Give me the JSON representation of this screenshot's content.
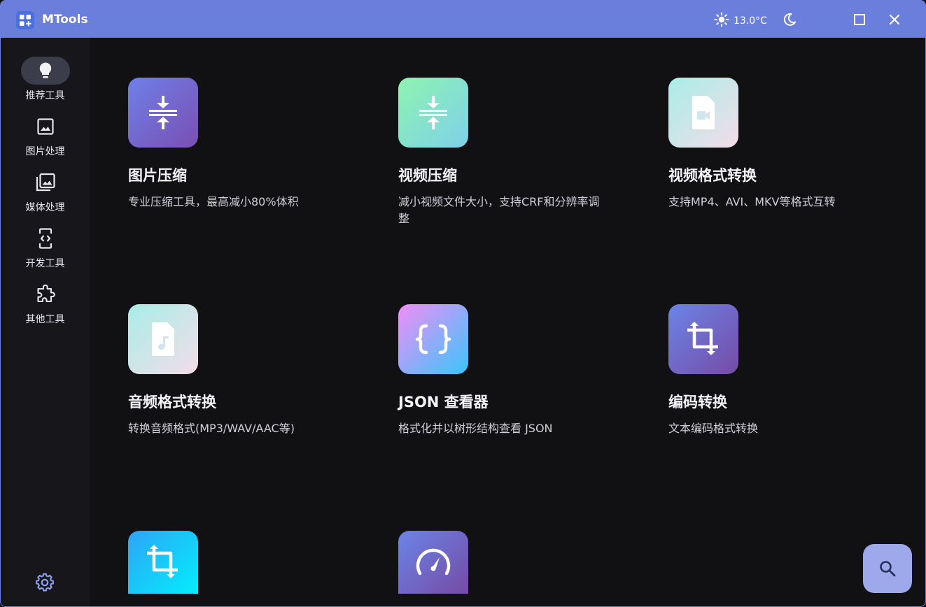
{
  "app": {
    "title": "MTools"
  },
  "titlebar": {
    "temperature": "13.0°C"
  },
  "sidebar": {
    "items": [
      {
        "label": "推荐工具",
        "icon": "lightbulb-icon",
        "active": true
      },
      {
        "label": "图片处理",
        "icon": "image-icon",
        "active": false
      },
      {
        "label": "媒体处理",
        "icon": "photo-library-icon",
        "active": false
      },
      {
        "label": "开发工具",
        "icon": "developer-mode-icon",
        "active": false
      },
      {
        "label": "其他工具",
        "icon": "extension-icon",
        "active": false
      }
    ],
    "settings_icon": "gear-icon"
  },
  "tools": [
    {
      "title": "图片压缩",
      "desc": "专业压缩工具，最高减小80%体积",
      "icon": "compress-icon"
    },
    {
      "title": "视频压缩",
      "desc": "减小视频文件大小，支持CRF和分辨率调整",
      "icon": "compress-icon"
    },
    {
      "title": "视频格式转换",
      "desc": "支持MP4、AVI、MKV等格式互转",
      "icon": "video-file-icon"
    },
    {
      "title": "音频格式转换",
      "desc": "转换音频格式(MP3/WAV/AAC等)",
      "icon": "audio-file-icon"
    },
    {
      "title": "JSON 查看器",
      "desc": "格式化并以树形结构查看 JSON",
      "icon": "braces-icon"
    },
    {
      "title": "编码转换",
      "desc": "文本编码格式转换",
      "icon": "crop-icon"
    },
    {
      "title": "",
      "desc": "",
      "icon": "crop-icon"
    },
    {
      "title": "",
      "desc": "",
      "icon": "speed-gauge-icon"
    }
  ],
  "fab": {
    "icon": "search-icon"
  }
}
